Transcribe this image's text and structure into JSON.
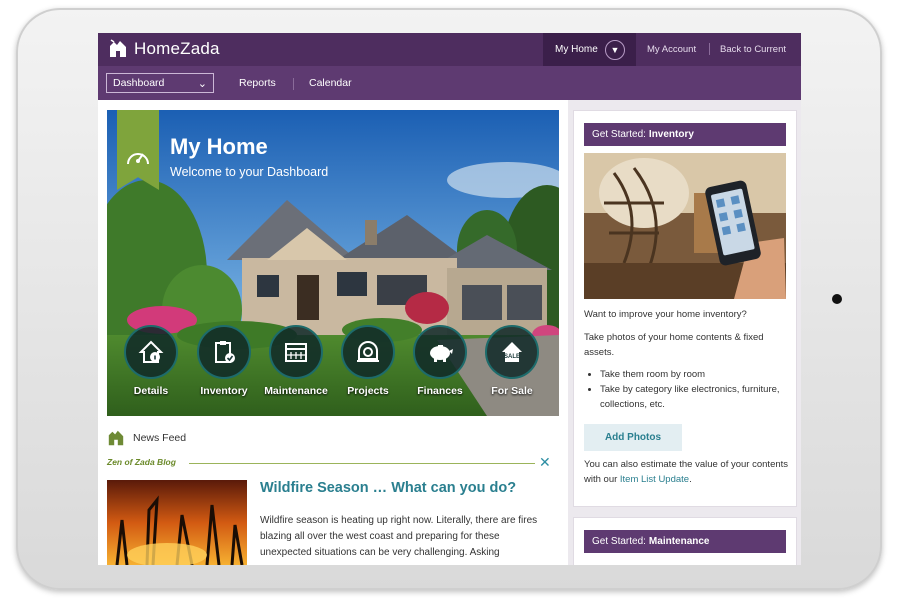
{
  "app": {
    "name": "HomeZada"
  },
  "header": {
    "my_home": "My Home",
    "my_account": "My Account",
    "back_to_current": "Back to Current"
  },
  "subnav": {
    "dashboard_select": "Dashboard",
    "reports": "Reports",
    "calendar": "Calendar"
  },
  "hero": {
    "title": "My Home",
    "subtitle": "Welcome to your Dashboard",
    "icons": [
      {
        "label": "Details",
        "icon": "house-info-icon"
      },
      {
        "label": "Inventory",
        "icon": "clipboard-check-icon"
      },
      {
        "label": "Maintenance",
        "icon": "calendar-grid-icon"
      },
      {
        "label": "Projects",
        "icon": "tape-measure-icon"
      },
      {
        "label": "Finances",
        "icon": "piggy-bank-icon"
      },
      {
        "label": "For Sale",
        "icon": "house-sale-icon"
      }
    ]
  },
  "news": {
    "label": "News Feed",
    "blog_label": "Zen of Zada Blog",
    "article_title": "Wildfire Season … What can you do?",
    "article_body": "Wildfire season is heating up right now. Literally, there are fires blazing all over the west coast and preparing for these unexpected situations can be very challenging.  Asking"
  },
  "sidebar": {
    "inventory_card": {
      "head_prefix": "Get Started:",
      "head_bold": "Inventory",
      "question": "Want to improve your home inventory?",
      "para": "Take photos of your home contents & fixed assets.",
      "bullets": [
        "Take them room by room",
        "Take by category like electronics, furniture, collections, etc."
      ],
      "button": "Add Photos",
      "foot_prefix": "You can also estimate the value of your contents with our ",
      "foot_link": "Item List Update",
      "foot_suffix": "."
    },
    "maintenance_card": {
      "head_prefix": "Get Started:",
      "head_bold": "Maintenance"
    }
  },
  "colors": {
    "brand_purple": "#4e2d5f",
    "accent_green": "#7fa43c",
    "link_teal": "#2a7f8f"
  }
}
